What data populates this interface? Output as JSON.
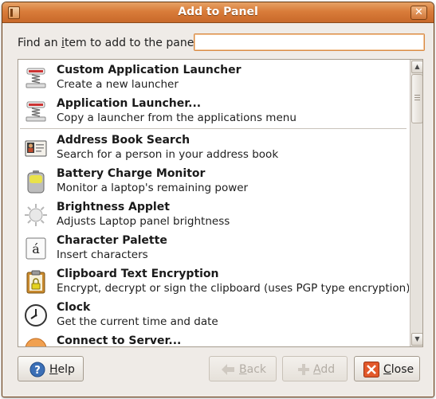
{
  "window": {
    "title": "Add to Panel",
    "close_glyph": "✕"
  },
  "find": {
    "label_before": "Find an ",
    "label_mnemonic": "i",
    "label_after": "tem to add to the panel:",
    "value": "",
    "placeholder": ""
  },
  "items": [
    {
      "name": "Custom Application Launcher",
      "desc": "Create a new launcher",
      "icon": "launcher-spring-icon"
    },
    {
      "name": "Application Launcher...",
      "desc": "Copy a launcher from the applications menu",
      "icon": "launcher-spring-icon"
    },
    {
      "name": "Address Book Search",
      "desc": "Search for a person in your address book",
      "icon": "address-card-icon"
    },
    {
      "name": "Battery Charge Monitor",
      "desc": "Monitor a laptop's remaining power",
      "icon": "battery-icon"
    },
    {
      "name": "Brightness Applet",
      "desc": "Adjusts Laptop panel brightness",
      "icon": "sun-icon"
    },
    {
      "name": "Character Palette",
      "desc": "Insert characters",
      "icon": "character-icon",
      "glyph": "á"
    },
    {
      "name": "Clipboard Text Encryption",
      "desc": "Encrypt, decrypt or sign the clipboard (uses PGP type encryption).",
      "icon": "clipboard-lock-icon"
    },
    {
      "name": "Clock",
      "desc": "Get the current time and date",
      "icon": "clock-icon"
    },
    {
      "name": "Connect to Server...",
      "desc": "",
      "icon": "globe-icon"
    }
  ],
  "scrollbar": {
    "up": "▲",
    "down": "▼"
  },
  "buttons": {
    "help": {
      "mnemonic": "H",
      "rest": "elp"
    },
    "back": {
      "mnemonic": "B",
      "rest": "ack",
      "enabled": false
    },
    "add": {
      "mnemonic": "A",
      "rest": "dd",
      "enabled": false
    },
    "close": {
      "mnemonic": "C",
      "rest": "lose"
    }
  },
  "colors": {
    "titlebar": "#d97c3a",
    "accent": "#d88a44",
    "window_bg": "#efebe7"
  }
}
